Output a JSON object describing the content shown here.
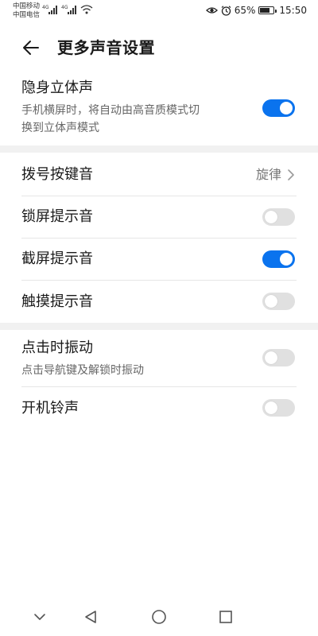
{
  "status_bar": {
    "carrier_1": "中国移动",
    "carrier_2": "中国电信",
    "network_1": "4G",
    "network_2": "4G",
    "battery_text": "65%",
    "battery_level": 0.65,
    "time": "15:50",
    "icons": [
      "signal-icon",
      "wifi-icon",
      "eye-comfort-icon",
      "alarm-icon",
      "battery-icon"
    ]
  },
  "header": {
    "title": "更多声音设置",
    "back_icon": "arrow-left-icon"
  },
  "settings": {
    "stereo": {
      "title": "隐身立体声",
      "subtitle_line1": "手机横屏时，将自动由高音质模式切",
      "subtitle_line2": "换到立体声模式",
      "enabled": true
    },
    "dial_tone": {
      "title": "拨号按键音",
      "value": "旋律"
    },
    "lock_sound": {
      "title": "锁屏提示音",
      "enabled": false
    },
    "screenshot_sound": {
      "title": "截屏提示音",
      "enabled": true
    },
    "touch_sound": {
      "title": "触摸提示音",
      "enabled": false
    },
    "vibrate_on_tap": {
      "title": "点击时振动",
      "subtitle": "点击导航键及解锁时振动",
      "enabled": false
    },
    "boot_ringtone": {
      "title": "开机铃声",
      "enabled": false
    }
  },
  "colors": {
    "accent": "#0a73ee",
    "toggle_off": "#e0e0e0",
    "section_gap": "#f1f1f1"
  },
  "nav_bar": {
    "icons": [
      "chevron-down-icon",
      "back-triangle-icon",
      "home-circle-icon",
      "recents-square-icon"
    ]
  }
}
